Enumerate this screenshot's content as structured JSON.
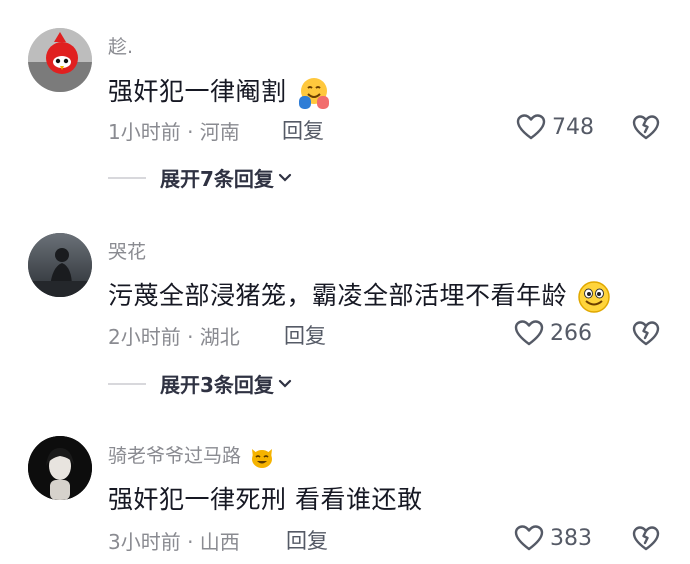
{
  "comments": [
    {
      "username": "趁.",
      "text": "强奸犯一律阉割",
      "emoji": "hugging-face",
      "time_location": "1小时前 · 河南",
      "reply_label": "回复",
      "likes": "748",
      "expand_label": "展开7条回复"
    },
    {
      "username": "哭花",
      "text": "污蔑全部浸猪笼，霸凌全部活埋不看年龄",
      "emoji": "smiling-face",
      "time_location": "2小时前 · 湖北",
      "reply_label": "回复",
      "likes": "266",
      "expand_label": "展开3条回复"
    },
    {
      "username": "骑老爷爷过马路",
      "username_emoji": "cat-face",
      "text": "强奸犯一律死刑 看看谁还敢",
      "time_location": "3小时前 · 山西",
      "reply_label": "回复",
      "likes": "383"
    }
  ],
  "colors": {
    "primary_text": "#161823",
    "secondary_text": "#8a8b91",
    "action_text": "#555a66",
    "divider": "#d8d8dc"
  }
}
